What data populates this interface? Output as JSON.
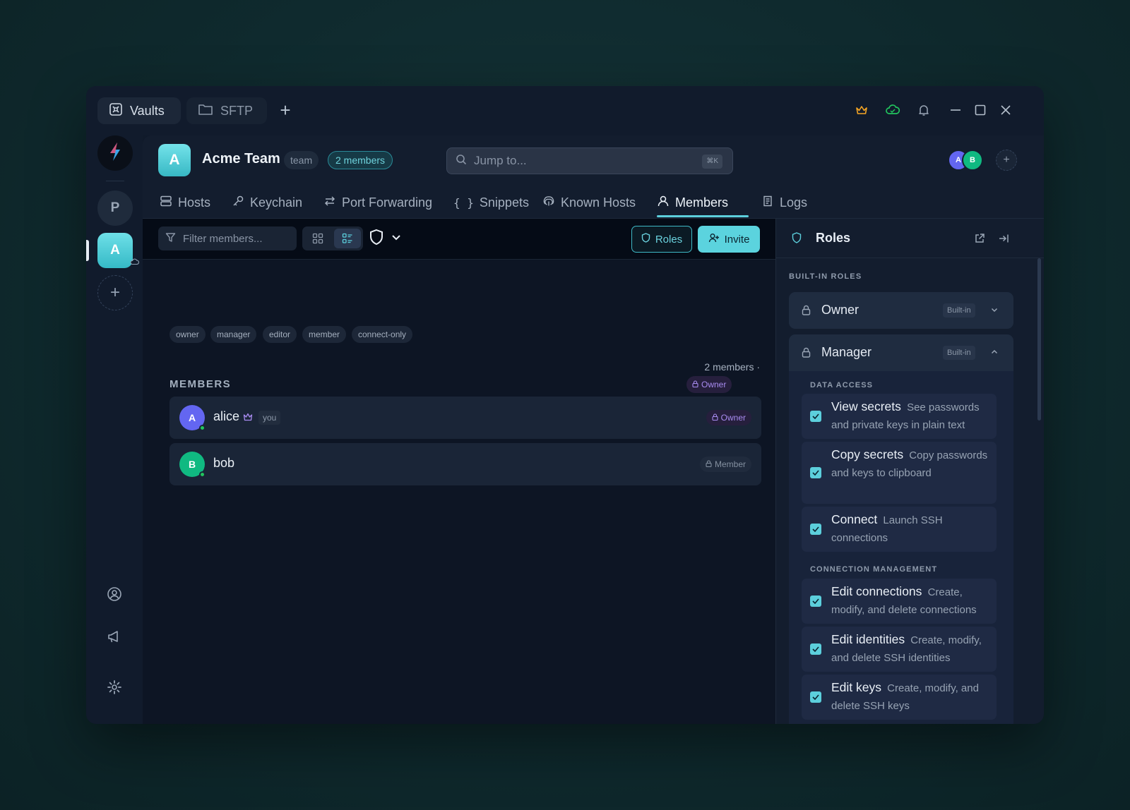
{
  "titlebar": {
    "tabs": [
      {
        "label": "Vaults",
        "icon": "vault-icon"
      },
      {
        "label": "SFTP",
        "icon": "folder-icon"
      }
    ],
    "add_tab": "+",
    "icons": [
      "crown-icon",
      "cloud-sync-icon",
      "bell-icon",
      "minimize-icon",
      "maximize-icon",
      "close-icon"
    ]
  },
  "rail": {
    "vaults": [
      "P",
      "A"
    ],
    "add": "+"
  },
  "header": {
    "team_initial": "A",
    "team_name": "Acme Team",
    "team_tag": "team",
    "members_pill": "2 members",
    "search_placeholder": "Jump to...",
    "search_shortcut": "⌘K",
    "avatars": [
      "A",
      "B"
    ],
    "add_avatar": "+"
  },
  "nav": {
    "tabs": [
      {
        "label": "Hosts",
        "icon": "server-icon"
      },
      {
        "label": "Keychain",
        "icon": "key-icon"
      },
      {
        "label": "Port Forwarding",
        "icon": "arrows-icon"
      },
      {
        "label": "Snippets",
        "icon": "braces-icon"
      },
      {
        "label": "Known Hosts",
        "icon": "fingerprint-icon"
      },
      {
        "label": "Members",
        "icon": "user-icon"
      },
      {
        "label": "Logs",
        "icon": "scroll-icon"
      }
    ],
    "active": "Members"
  },
  "toolbar": {
    "filter_placeholder": "Filter members...",
    "roles_button": "Roles",
    "invite_button": "Invite"
  },
  "content": {
    "role_chips": [
      "owner",
      "manager",
      "editor",
      "member",
      "connect-only"
    ],
    "section_title": "MEMBERS",
    "count_text": "2 members ·",
    "count_badge": "Owner",
    "members": [
      {
        "initial": "A",
        "name": "alice",
        "you": "you",
        "role": "Owner",
        "avatar_color": "#6366f1"
      },
      {
        "initial": "B",
        "name": "bob",
        "you": "",
        "role": "Member",
        "avatar_color": "#10b981"
      }
    ]
  },
  "panel": {
    "title": "Roles",
    "section_label": "BUILT-IN ROLES",
    "roles": [
      {
        "name": "Owner",
        "tag": "Built-in",
        "expanded": false
      },
      {
        "name": "Manager",
        "tag": "Built-in",
        "expanded": true
      }
    ],
    "groups": [
      {
        "title": "DATA ACCESS",
        "perms": [
          {
            "name": "View secrets",
            "desc": "See passwords and private keys in plain text",
            "checked": true
          },
          {
            "name": "Copy secrets",
            "desc": "Copy passwords and keys to clipboard",
            "checked": true
          },
          {
            "name": "Connect",
            "desc": "Launch SSH connections",
            "checked": true
          }
        ]
      },
      {
        "title": "CONNECTION MANAGEMENT",
        "perms": [
          {
            "name": "Edit connections",
            "desc": "Create, modify, and delete connections",
            "checked": true
          },
          {
            "name": "Edit identities",
            "desc": "Create, modify, and delete SSH identities",
            "checked": true
          },
          {
            "name": "Edit keys",
            "desc": "Create, modify, and delete SSH keys",
            "checked": true
          }
        ]
      }
    ]
  },
  "colors": {
    "accent": "#5ccfdc",
    "owner_purple": "#a88bf0",
    "online": "#22c55e"
  }
}
